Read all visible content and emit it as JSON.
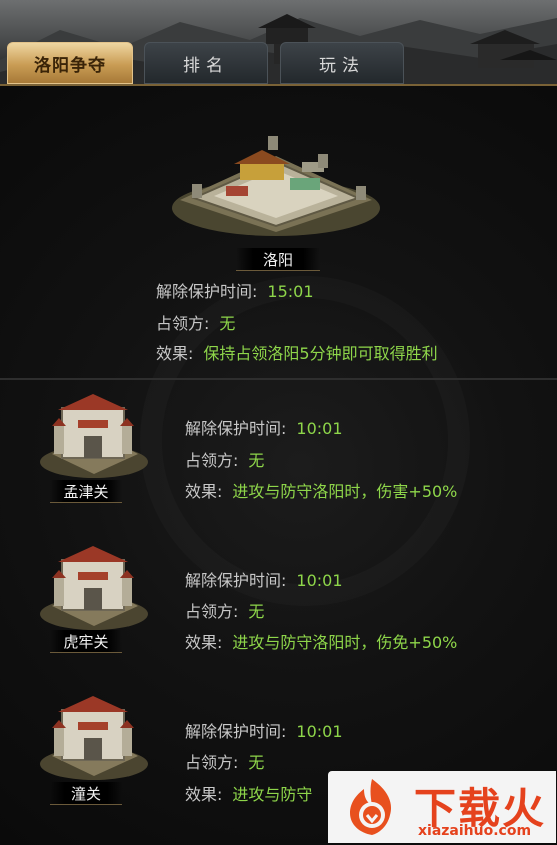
{
  "tabs": [
    {
      "label": "洛阳争夺",
      "active": true
    },
    {
      "label": "排名",
      "active": false
    },
    {
      "label": "玩法",
      "active": false
    }
  ],
  "main_city": {
    "name": "洛阳",
    "protection_label": "解除保护时间:",
    "protection_value": "15:01",
    "occupier_label": "占领方:",
    "occupier_value": "无",
    "effect_label": "效果:",
    "effect_value": "保持占领洛阳5分钟即可取得胜利"
  },
  "passes": [
    {
      "name": "孟津关",
      "protection_label": "解除保护时间:",
      "protection_value": "10:01",
      "occupier_label": "占领方:",
      "occupier_value": "无",
      "effect_label": "效果:",
      "effect_value": "进攻与防守洛阳时，伤害+50%"
    },
    {
      "name": "虎牢关",
      "protection_label": "解除保护时间:",
      "protection_value": "10:01",
      "occupier_label": "占领方:",
      "occupier_value": "无",
      "effect_label": "效果:",
      "effect_value": "进攻与防守洛阳时，伤免+50%"
    },
    {
      "name": "潼关",
      "protection_label": "解除保护时间:",
      "protection_value": "10:01",
      "occupier_label": "占领方:",
      "occupier_value": "无",
      "effect_label": "效果:",
      "effect_value": "进攻与防守"
    }
  ],
  "watermark": {
    "brand": "下载火",
    "domain": "xiazaihuo.com"
  },
  "colors": {
    "value_green": "#8ed64a",
    "label_gray": "#c8c8c8",
    "tab_gold": "#c99c54"
  }
}
